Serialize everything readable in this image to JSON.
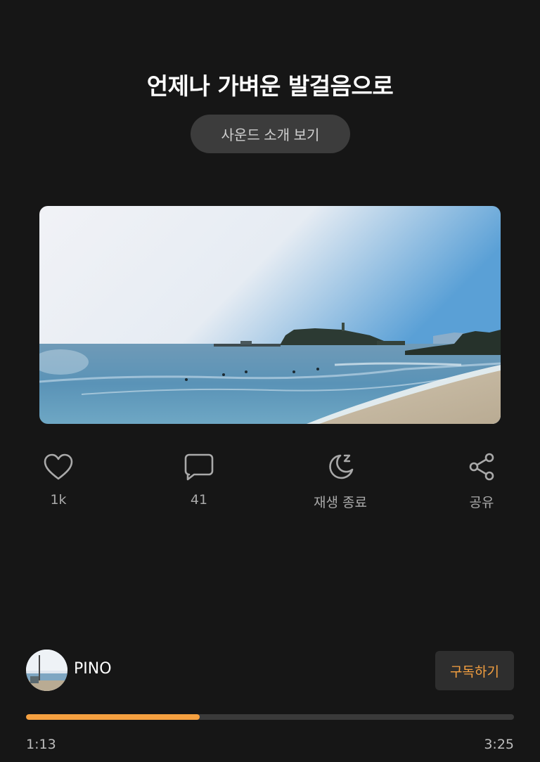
{
  "header": {
    "title": "언제나 가벼운 발걸음으로",
    "intro_button_label": "사운드 소개 보기"
  },
  "cover": {
    "image_icon": "seaside-beach-photo"
  },
  "actions": [
    {
      "icon": "heart-icon",
      "label": "1k"
    },
    {
      "icon": "comment-icon",
      "label": "41"
    },
    {
      "icon": "sleep-timer-icon",
      "label": "재생 종료"
    },
    {
      "icon": "share-icon",
      "label": "공유"
    }
  ],
  "artist": {
    "name": "PINO",
    "subscribe_label": "구독하기"
  },
  "player": {
    "elapsed": "1:13",
    "duration": "3:25",
    "progress_fraction": 0.356
  },
  "colors": {
    "background": "#161616",
    "accent": "#f5a040",
    "muted_text": "#a9a9a9",
    "button_bg": "#3c3c3c"
  }
}
